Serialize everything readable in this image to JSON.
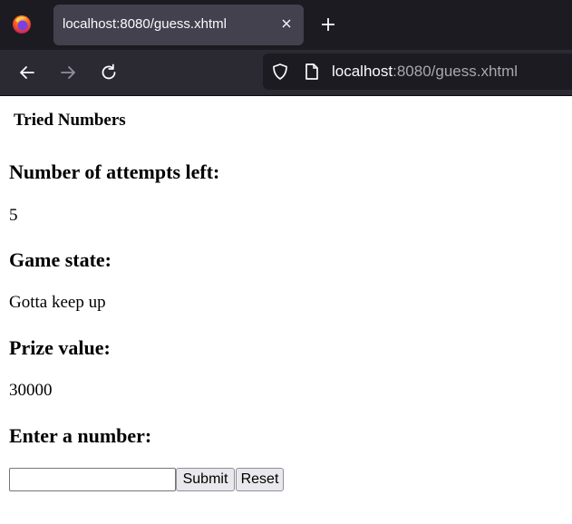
{
  "browser": {
    "tab_title": "localhost:8080/guess.xhtml",
    "url_host": "localhost",
    "url_rest": ":8080/guess.xhtml",
    "colors": {
      "tabbar": "#1c1b22",
      "tab_active": "#42414d",
      "navbar": "#2b2a33"
    }
  },
  "page": {
    "tried_heading": "Tried Numbers",
    "attempts_heading": "Number of attempts left:",
    "attempts_value": "5",
    "state_heading": "Game state:",
    "state_value": "Gotta keep up",
    "prize_heading": "Prize value:",
    "prize_value": "30000",
    "enter_heading": "Enter a number:",
    "number_input_value": "",
    "submit_label": "Submit",
    "reset_label": "Reset"
  }
}
